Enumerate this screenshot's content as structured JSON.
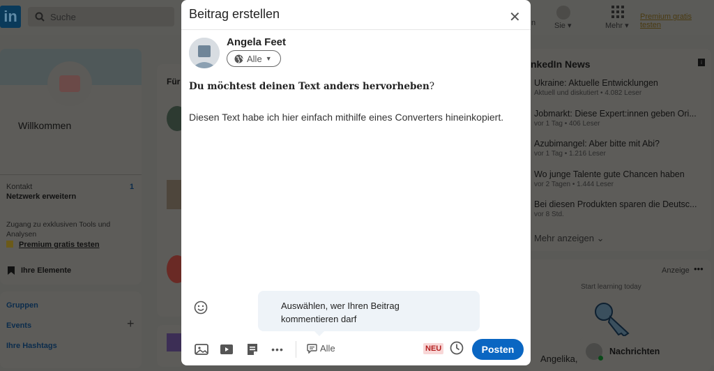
{
  "nav": {
    "logo": "in",
    "search_placeholder": "Suche",
    "me_label": "Sie",
    "more_label": "Mehr",
    "premium_link": "Premium gratis testen",
    "partial_label": "n"
  },
  "profile_card": {
    "welcome": "Willkommen",
    "contacts_label": "Kontakt",
    "contacts_count": "1",
    "network_label": "Netzwerk erweitern",
    "tools_text_1": "Zugang zu exklusiven Tools und",
    "tools_text_2": "Analysen",
    "premium_link": "Premium gratis testen",
    "my_items": "Ihre Elemente"
  },
  "left_links": {
    "groups": "Gruppen",
    "events": "Events",
    "hashtags": "Ihre Hashtags"
  },
  "feed": {
    "partial_heading": "Für"
  },
  "news": {
    "title": "nkedIn News",
    "items": [
      {
        "title": "Ukraine: Aktuelle Entwicklungen",
        "sub": "Aktuell und diskutiert • 4.082 Leser"
      },
      {
        "title": "Jobmarkt: Diese Expert:innen geben Ori...",
        "sub": "vor 1 Tag • 406 Leser"
      },
      {
        "title": "Azubimangel: Aber bitte mit Abi?",
        "sub": "vor 1 Tag • 1.216 Leser"
      },
      {
        "title": "Wo junge Talente gute Chancen haben",
        "sub": "vor 2 Tagen • 1.444 Leser"
      },
      {
        "title": "Bei diesen Produkten sparen die Deutsc...",
        "sub": "vor 8 Std."
      }
    ],
    "show_more": "Mehr anzeigen"
  },
  "ad": {
    "label": "Anzeige",
    "tagline": "Start learning today",
    "partial_name": "Angelika,"
  },
  "messages": {
    "label": "Nachrichten"
  },
  "modal": {
    "title": "Beitrag erstellen",
    "author": "Angela Feet",
    "audience": "Alle",
    "bold_text": "Du möchtest deinen Text anders hervorheben",
    "bold_suffix": "?",
    "body_text": "Diesen Text habe ich hier einfach mithilfe eines Converters hineinkopiert.",
    "tooltip_line1": "Auswählen, wer Ihren Beitrag",
    "tooltip_line2": "kommentieren darf",
    "comment_audience": "Alle",
    "new_badge": "NEU",
    "post_button": "Posten"
  },
  "colors": {
    "primary": "#0a66c2",
    "overlay": "#5a5a57",
    "tooltip_bg": "#eef3f8",
    "badge_bg": "#f8d7d7",
    "badge_text": "#b42020"
  }
}
